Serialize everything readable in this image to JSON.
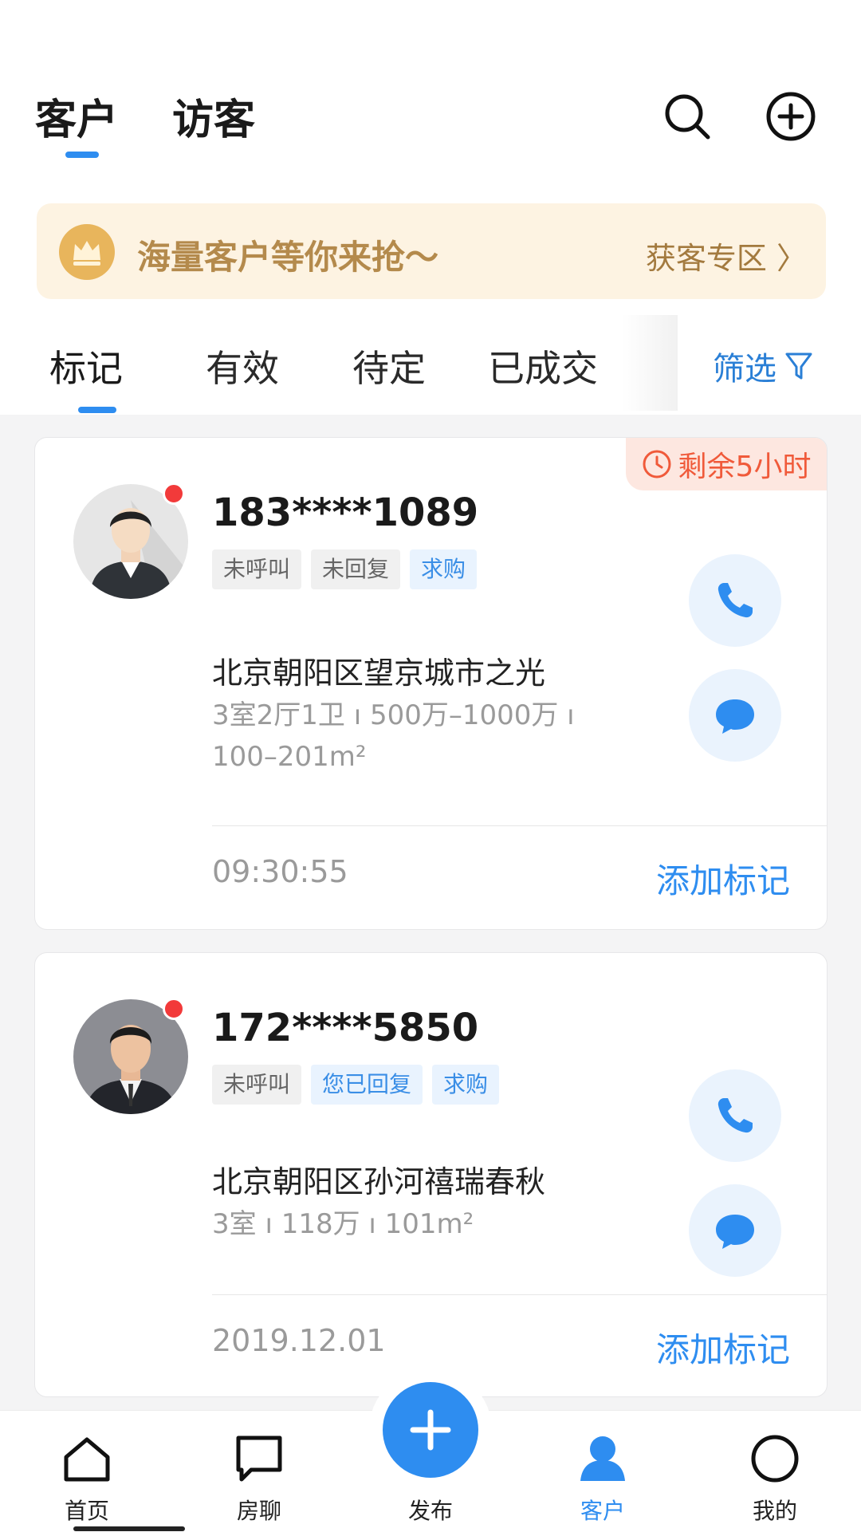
{
  "header": {
    "tabs": [
      {
        "label": "客户",
        "active": true
      },
      {
        "label": "访客",
        "active": false
      }
    ],
    "search_icon": "search-icon",
    "add_icon": "plus-circle-icon"
  },
  "banner": {
    "icon": "crown-icon",
    "text": "海量客户等你来抢～",
    "link": "获客专区 〉"
  },
  "filter_tabs": {
    "items": [
      {
        "label": "标记",
        "active": true
      },
      {
        "label": "有效",
        "active": false
      },
      {
        "label": "待定",
        "active": false
      },
      {
        "label": "已成交",
        "active": false
      }
    ],
    "filter_label": "筛选",
    "filter_icon": "funnel-icon"
  },
  "customers": [
    {
      "phone": "183****1089",
      "remaining": "剩余5小时",
      "tags": [
        "未呼叫",
        "未回复",
        "求购"
      ],
      "address": "北京朝阳区望京城市之光",
      "spec": "3室2厅1卫 ı 500万–1000万 ı 100–201m²",
      "time": "09:30:55",
      "action": "添加标记"
    },
    {
      "phone": "172****5850",
      "tags": [
        "未呼叫",
        "您已回复",
        "求购"
      ],
      "address": "北京朝阳区孙河禧瑞春秋",
      "spec": "3室 ı 118万 ı 101m²",
      "time": "2019.12.01",
      "action": "添加标记"
    }
  ],
  "nav": {
    "items": [
      {
        "label": "首页",
        "icon": "home-icon",
        "active": false
      },
      {
        "label": "房聊",
        "icon": "chat-icon",
        "active": false
      },
      {
        "label": "发布",
        "icon": "plus-icon",
        "active": false
      },
      {
        "label": "客户",
        "icon": "person-icon",
        "active": true
      },
      {
        "label": "我的",
        "icon": "profile-icon",
        "active": false
      }
    ]
  },
  "colors": {
    "accent": "#2e8df0",
    "warning": "#f05a3a",
    "gold": "#b48a4c"
  }
}
